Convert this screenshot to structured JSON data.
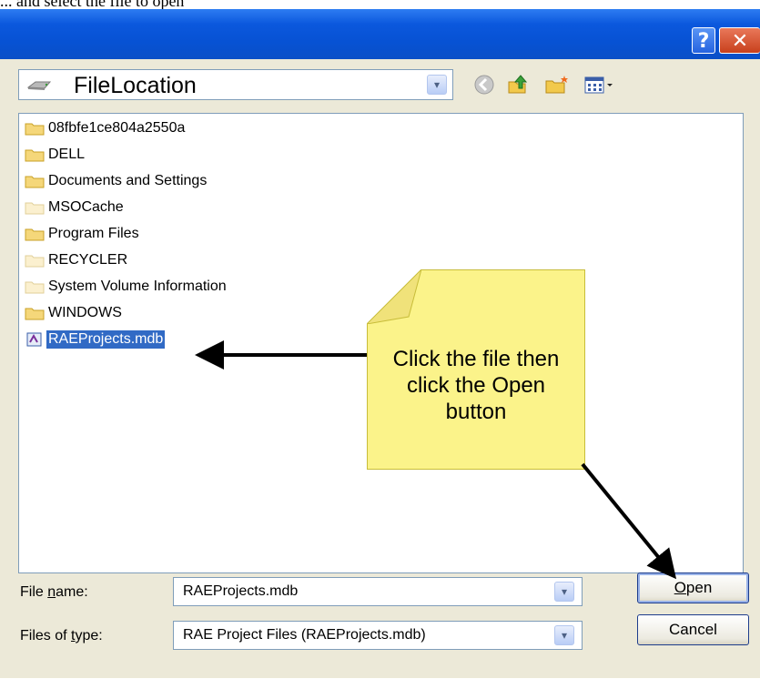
{
  "top_text": "... and select the file to open",
  "window": {
    "help_glyph": "?",
    "close_glyph": "✕"
  },
  "look_in": {
    "value": "FileLocation",
    "dropdown_glyph": "▾"
  },
  "files": [
    {
      "name": "08fbfe1ce804a2550a",
      "type": "folder"
    },
    {
      "name": "DELL",
      "type": "folder"
    },
    {
      "name": "Documents and Settings",
      "type": "folder"
    },
    {
      "name": "MSOCache",
      "type": "folder-hidden"
    },
    {
      "name": "Program Files",
      "type": "folder"
    },
    {
      "name": "RECYCLER",
      "type": "folder-hidden"
    },
    {
      "name": "System Volume Information",
      "type": "folder-hidden"
    },
    {
      "name": "WINDOWS",
      "type": "folder"
    },
    {
      "name": "RAEProjects.mdb",
      "type": "mdb-file",
      "selected": true
    }
  ],
  "callout": {
    "line1": "Click the file then",
    "line2": "click the Open",
    "line3": "button"
  },
  "file_name": {
    "label_pre": "File ",
    "label_u": "n",
    "label_post": "ame:",
    "value": "RAEProjects.mdb"
  },
  "file_type": {
    "label_pre": "Files of ",
    "label_u": "t",
    "label_post": "ype:",
    "value": "RAE Project Files (RAEProjects.mdb)"
  },
  "buttons": {
    "open_u": "O",
    "open_rest": "pen",
    "cancel": "Cancel"
  },
  "colors": {
    "titlebar": "#0752d4",
    "dialog_bg": "#ece9d8",
    "selection": "#316ac5",
    "note": "#fbf38a"
  }
}
